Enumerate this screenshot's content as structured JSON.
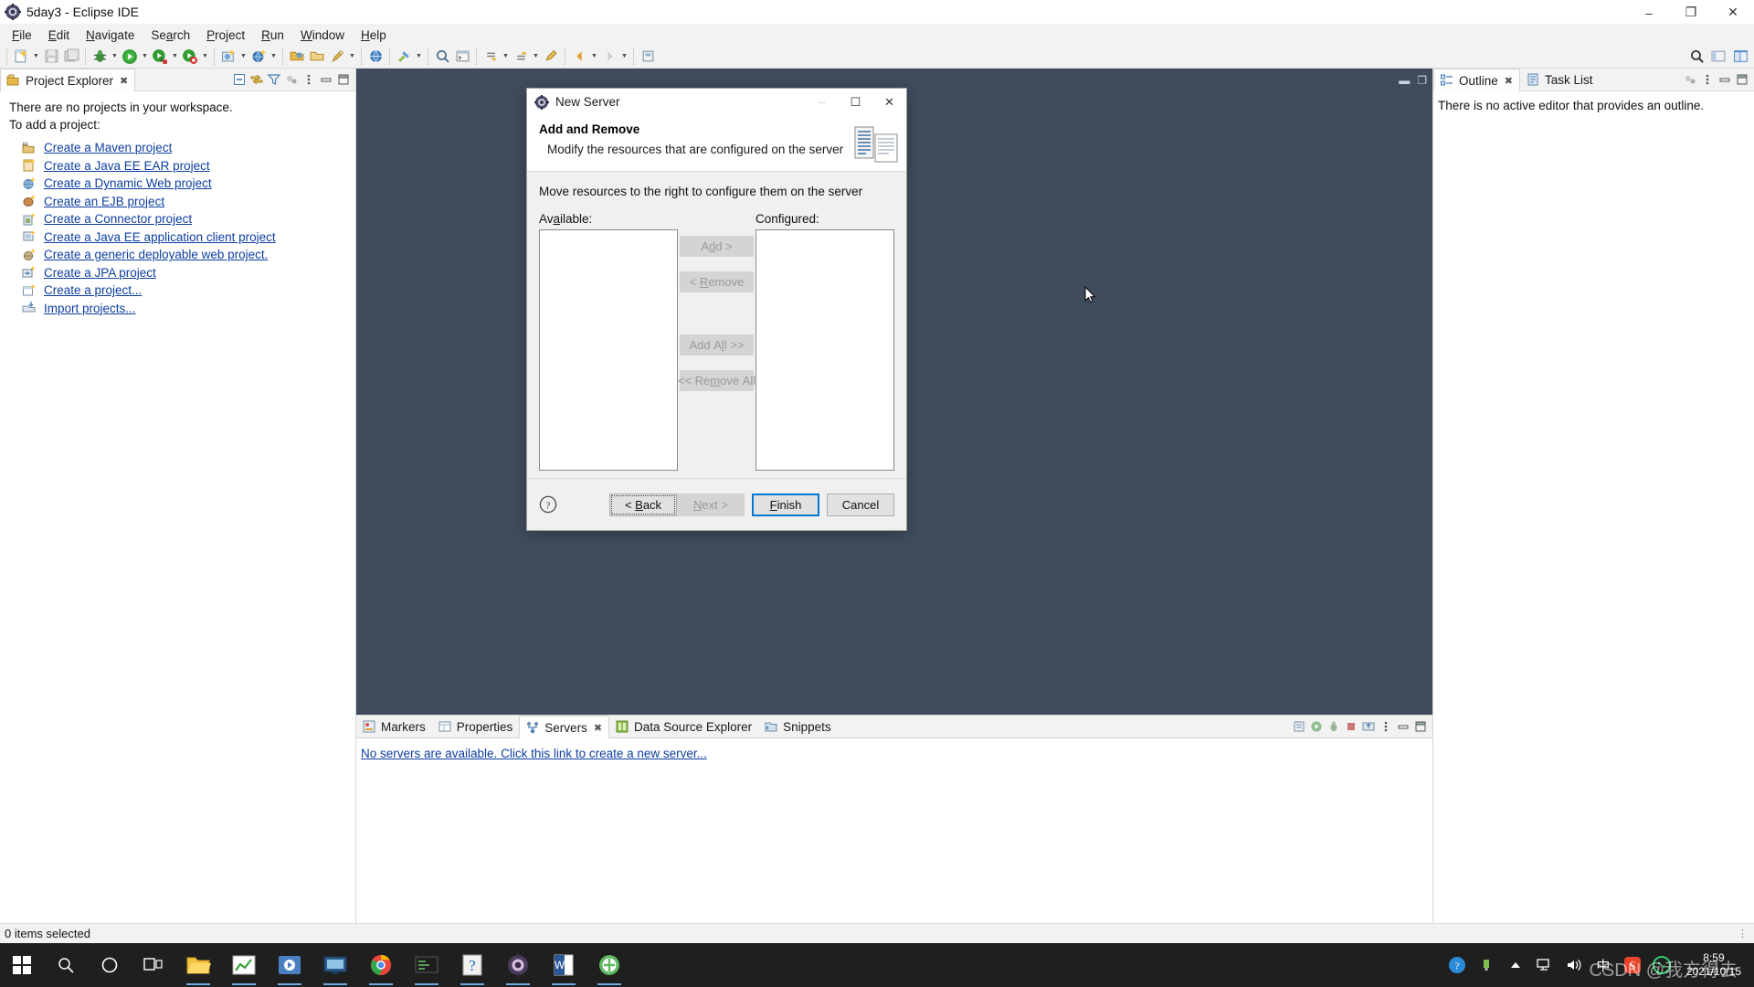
{
  "window": {
    "title": "5day3 - Eclipse IDE",
    "icon": "eclipse-icon",
    "minimize": "–",
    "maximize": "❐",
    "close": "✕"
  },
  "menubar": {
    "items": [
      {
        "label": "File",
        "mnemonic": "F"
      },
      {
        "label": "Edit",
        "mnemonic": "E"
      },
      {
        "label": "Navigate",
        "mnemonic": "N"
      },
      {
        "label": "Search",
        "mnemonic": "a"
      },
      {
        "label": "Project",
        "mnemonic": "P"
      },
      {
        "label": "Run",
        "mnemonic": "R"
      },
      {
        "label": "Window",
        "mnemonic": "W"
      },
      {
        "label": "Help",
        "mnemonic": "H"
      }
    ]
  },
  "toolbar": {
    "items": [
      "new-wizard-icon",
      "save-icon",
      "save-all-icon",
      "debug-icon",
      "run-icon",
      "run-server-icon",
      "stop-server-icon",
      "new-java-project-icon",
      "new-dynamic-web-icon",
      "open-type-icon",
      "open-resource-icon",
      "quick-access-icon",
      "web-browser-icon",
      "external-tools-icon",
      "search-icon",
      "console-icon",
      "next-annotation-icon",
      "previous-annotation-icon",
      "last-edit-icon",
      "back-icon",
      "forward-icon",
      "pin-editor-icon"
    ],
    "right_items": [
      "search-toolbar-icon",
      "perspective-open-icon",
      "perspective-java-ee-icon"
    ]
  },
  "project_explorer": {
    "tab_label": "Project Explorer",
    "tab_icon": "project-explorer-icon",
    "close_glyph": "✖",
    "toolbar_icons": [
      "collapse-all-icon",
      "link-with-editor-icon",
      "view-menu-filter-icon",
      "focus-on-active-task-icon",
      "view-menu-icon",
      "minimize-icon",
      "maximize-icon"
    ],
    "empty_text_line1": "There are no projects in your workspace.",
    "empty_text_line2": "To add a project:",
    "links": [
      {
        "label": "Create a Maven project",
        "icon": "maven-project-icon"
      },
      {
        "label": "Create a Java EE EAR project",
        "icon": "ear-project-icon"
      },
      {
        "label": "Create a Dynamic Web project",
        "icon": "dynamic-web-project-icon"
      },
      {
        "label": "Create an EJB project",
        "icon": "ejb-project-icon"
      },
      {
        "label": "Create a Connector project",
        "icon": "connector-project-icon"
      },
      {
        "label": "Create a Java EE application client project",
        "icon": "appclient-project-icon"
      },
      {
        "label": "Create a generic deployable web project.",
        "icon": "generic-web-project-icon"
      },
      {
        "label": "Create a JPA project",
        "icon": "jpa-project-icon"
      },
      {
        "label": "Create a project...",
        "icon": "new-project-icon"
      },
      {
        "label": "Import projects...",
        "icon": "import-projects-icon"
      }
    ]
  },
  "bottom_panel": {
    "tabs": [
      {
        "label": "Markers",
        "icon": "markers-icon",
        "active": false
      },
      {
        "label": "Properties",
        "icon": "properties-icon",
        "active": false
      },
      {
        "label": "Servers",
        "icon": "servers-icon",
        "active": true
      },
      {
        "label": "Data Source Explorer",
        "icon": "data-source-explorer-icon",
        "active": false
      },
      {
        "label": "Snippets",
        "icon": "snippets-icon",
        "active": false
      }
    ],
    "close_glyph": "✖",
    "toolbar_icons": [
      "new-server-icon",
      "start-icon",
      "debug-server-icon",
      "stop-server-icon",
      "publish-icon",
      "view-menu-icon",
      "minimize-icon",
      "maximize-icon"
    ],
    "servers_link": "No servers are available. Click this link to create a new server..."
  },
  "right_panel": {
    "tabs": [
      {
        "label": "Outline",
        "icon": "outline-icon",
        "active": true
      },
      {
        "label": "Task List",
        "icon": "task-list-icon",
        "active": false
      }
    ],
    "close_glyph": "✖",
    "toolbar_icons": [
      "focus-on-active-task-icon",
      "view-menu-icon",
      "minimize-icon",
      "maximize-icon"
    ],
    "outline_message": "There is no active editor that provides an outline."
  },
  "statusbar": {
    "text": "0 items selected",
    "right_glyph": "⋮"
  },
  "dialog": {
    "title": "New Server",
    "icon": "new-server-dialog-icon",
    "minimize": "–",
    "maximize": "☐",
    "close": "✕",
    "heading": "Add and Remove",
    "subheading": "Modify the resources that are configured on the server",
    "banner_icon": "server-wizard-banner-icon",
    "instruction": "Move resources to the right to configure them on the server",
    "available_label": "Available:",
    "available_mnemonic": "A",
    "configured_label": "Configured:",
    "configured_mnemonic": "C",
    "available_items": [],
    "configured_items": [],
    "transfer_buttons": [
      {
        "name": "add-button",
        "label": "Add >",
        "mnemonic": "d",
        "enabled": false
      },
      {
        "name": "remove-button",
        "label": "< Remove",
        "mnemonic": "R",
        "enabled": false
      },
      {
        "name": "add-all-button",
        "label": "Add All >>",
        "mnemonic": "l",
        "enabled": false
      },
      {
        "name": "remove-all-button",
        "label": "<< Remove All",
        "mnemonic": "m",
        "enabled": false
      }
    ],
    "help_icon": "help-icon",
    "footer_buttons": [
      {
        "name": "back-button",
        "label": "< Back",
        "mnemonic": "B",
        "enabled": true,
        "state": "focused"
      },
      {
        "name": "next-button",
        "label": "Next >",
        "mnemonic": "N",
        "enabled": false,
        "state": "disabled"
      },
      {
        "name": "finish-button",
        "label": "Finish",
        "mnemonic": "F",
        "enabled": true,
        "state": "default"
      },
      {
        "name": "cancel-button",
        "label": "Cancel",
        "mnemonic": "",
        "enabled": true,
        "state": "normal"
      }
    ]
  },
  "taskbar": {
    "start_icon": "windows-start-icon",
    "search_icon": "search-icon",
    "cortana_icon": "cortana-icon",
    "taskview_icon": "task-view-icon",
    "apps": [
      {
        "name": "file-explorer-icon",
        "running": true
      },
      {
        "name": "chart-app-icon",
        "running": true
      },
      {
        "name": "media-app-icon",
        "running": true
      },
      {
        "name": "vm-app-icon",
        "running": true
      },
      {
        "name": "chrome-icon",
        "running": true
      },
      {
        "name": "editor-app-icon",
        "running": true
      },
      {
        "name": "help-app-icon",
        "running": true
      },
      {
        "name": "eclipse-taskbar-icon",
        "running": true
      },
      {
        "name": "word-icon",
        "running": true
      },
      {
        "name": "tomcat-icon",
        "running": true
      }
    ],
    "tray": [
      {
        "name": "help-tray-icon"
      },
      {
        "name": "usb-tray-icon"
      },
      {
        "name": "show-hidden-icons-icon"
      },
      {
        "name": "network-tray-icon"
      },
      {
        "name": "volume-tray-icon"
      },
      {
        "name": "ime-chinese-icon",
        "label": "中"
      },
      {
        "name": "sogou-input-icon"
      },
      {
        "name": "wechat-tray-icon"
      }
    ],
    "clock_time": "8:59",
    "clock_date": "2021/10/15",
    "watermark": "CSDN @我方得去"
  }
}
